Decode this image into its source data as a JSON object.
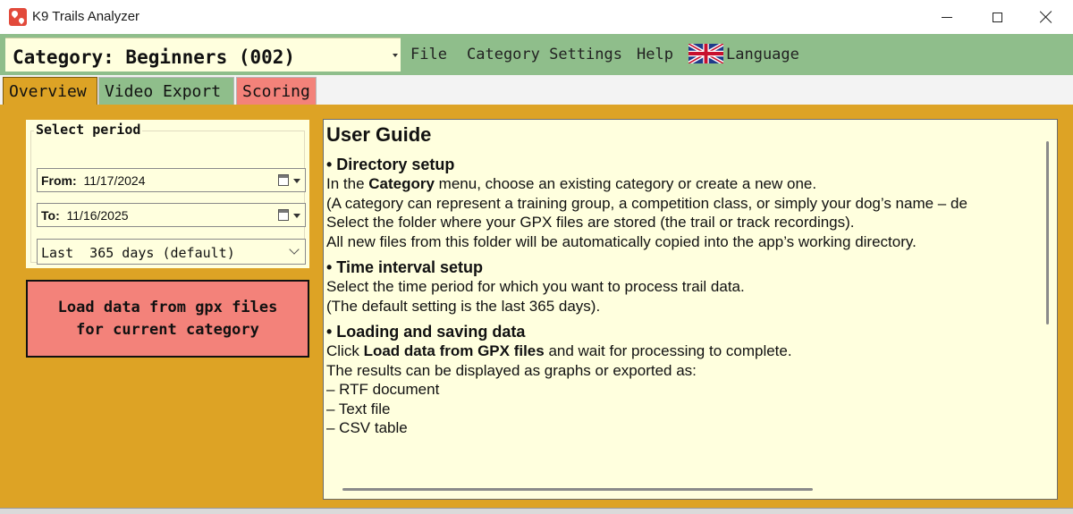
{
  "window": {
    "title": "K9  Trails Analyzer",
    "app_icon": "map-pins-icon",
    "controls": [
      "minimize-icon",
      "maximize-icon",
      "close-icon"
    ]
  },
  "menubar": {
    "category_label": "Category: Beginners (002)",
    "items": {
      "file": "File",
      "category_settings": "Category Settings",
      "help": "Help",
      "language": "Language"
    },
    "language_flag": "uk-flag-icon"
  },
  "tabs": [
    {
      "label": "Overview",
      "active": true,
      "color": "#dda325"
    },
    {
      "label": "Video Export",
      "active": false,
      "color": "#8fbe8b"
    },
    {
      "label": "Scoring",
      "active": false,
      "color": "#f3827a"
    }
  ],
  "period": {
    "title": "Select period",
    "from_label": "From:",
    "from_value": "11/17/2024",
    "to_label": "To:",
    "to_value": "11/16/2025",
    "range_selected": "Last  365 days (default)"
  },
  "load_button": {
    "label": "Load data from gpx files\nfor current category"
  },
  "guide": {
    "title": "User Guide",
    "sections": [
      {
        "heading": "• Directory setup",
        "lines": [
          "(A category can represent a training group, a competition class, or simply your dog’s name – de",
          "Select the folder where your GPX files are stored (the trail or track recordings).",
          "All new files from this folder will be automatically copied into the app’s working directory."
        ],
        "line1_pre": "In the ",
        "line1_bold": "Category",
        "line1_post": " menu, choose an existing category or create a new one."
      },
      {
        "heading": "• Time interval setup",
        "lines": [
          "Select the time period for which you want to process trail data.",
          "(The default setting is the last 365 days)."
        ]
      },
      {
        "heading": "• Loading and saving data",
        "line1_pre": "Click ",
        "line1_bold": "Load data from GPX files",
        "line1_post": " and wait for processing to complete.",
        "lines": [
          "The results can be displayed as graphs or exported as:",
          "– RTF document",
          "– Text file",
          "– CSV table"
        ]
      }
    ]
  },
  "colors": {
    "menubar": "#8fbe8b",
    "main_bg": "#dda325",
    "panel_bg": "#ffffde",
    "load_button": "#f3827a"
  }
}
